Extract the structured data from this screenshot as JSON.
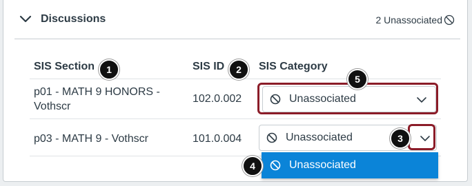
{
  "section": {
    "title": "Discussions",
    "unassociated_count": "2 Unassociated",
    "expanded": true
  },
  "table": {
    "headers": [
      "SIS Section",
      "SIS ID",
      "SIS Category"
    ],
    "rows": [
      {
        "section": "p01 - MATH 9 HONORS - Vothscr",
        "section_line1": "p01 - MATH 9 HONORS -",
        "section_line2": "Vothscr",
        "sis_id": "102.0.002",
        "category": "Unassociated"
      },
      {
        "section": "p03 - MATH 9 - Vothscr",
        "sis_id": "101.0.004",
        "category": "Unassociated"
      }
    ]
  },
  "dropdown": {
    "open_on_row": 2,
    "options": [
      "Unassociated"
    ],
    "highlighted_option": "Unassociated"
  },
  "callouts": [
    "1",
    "2",
    "3",
    "4",
    "5"
  ],
  "colors": {
    "highlight_border": "#8b1c28",
    "option_selected_bg": "#0b84d8",
    "text": "#2d3b45",
    "border": "#c7cdd1"
  },
  "icons": {
    "expand": "chevron-down-icon",
    "unassociated": "no-entry-icon",
    "select_arrow": "chevron-down-icon"
  }
}
